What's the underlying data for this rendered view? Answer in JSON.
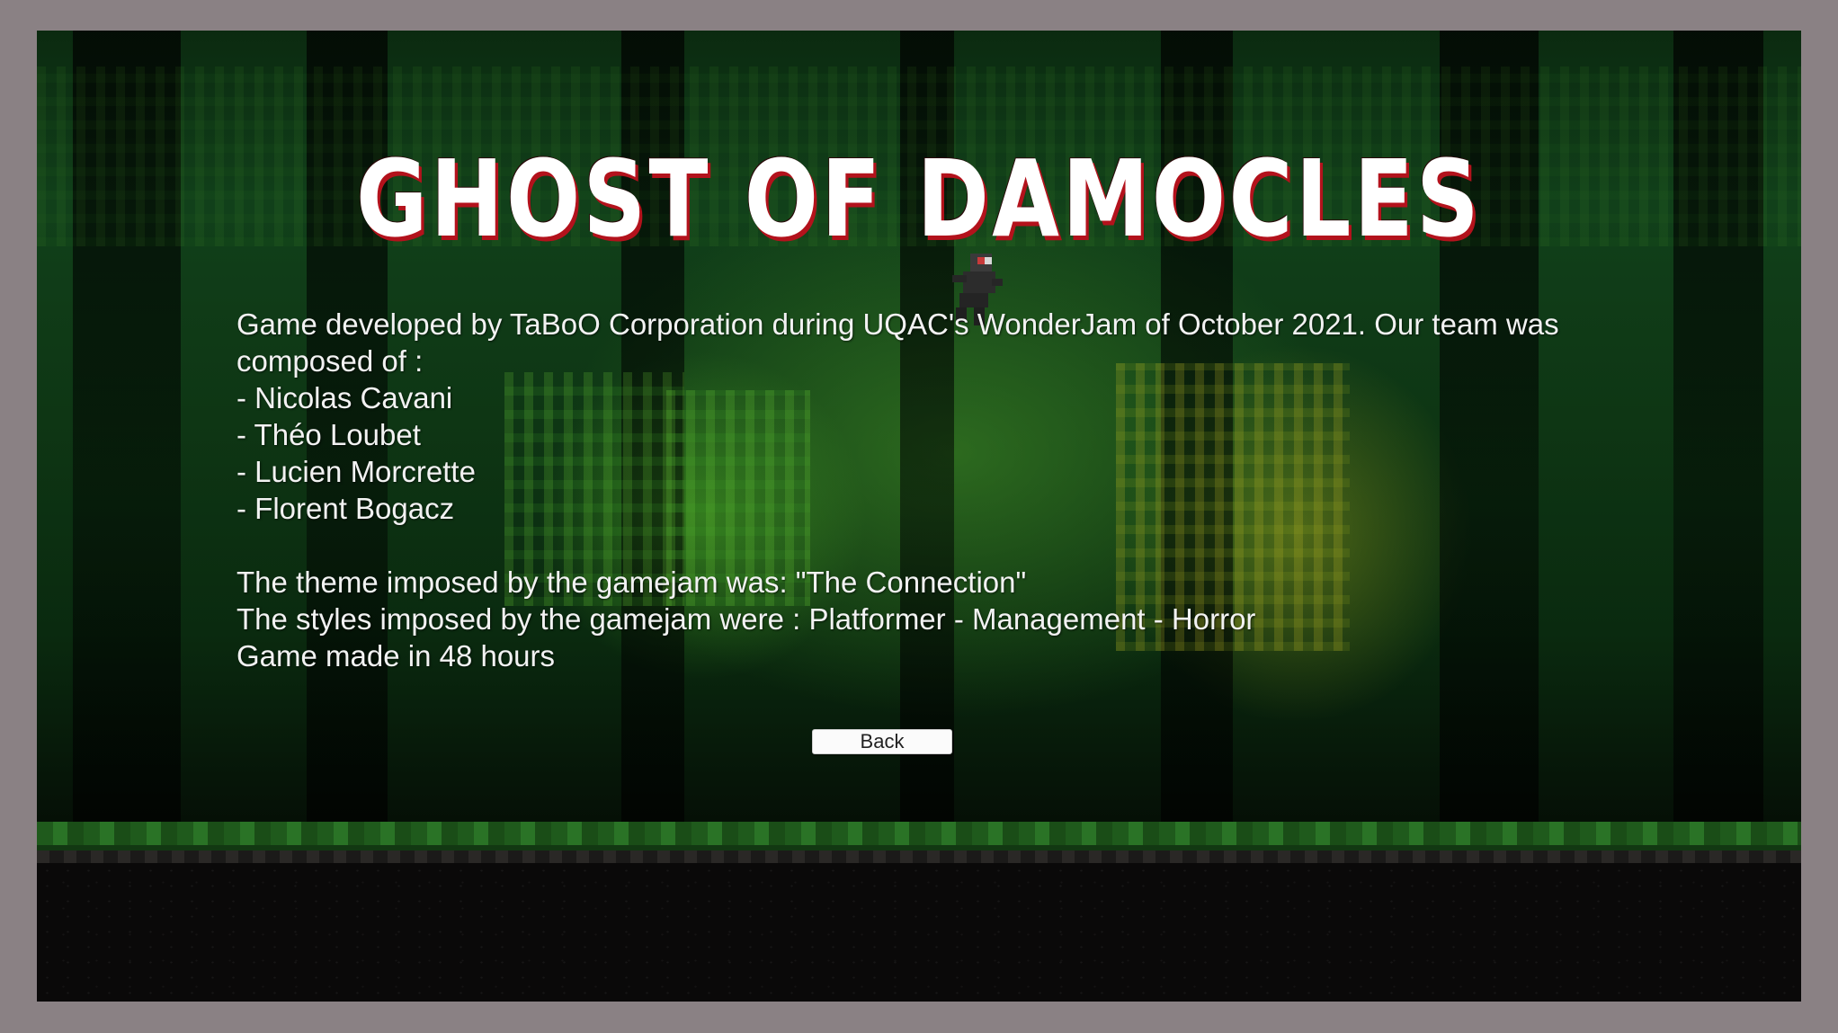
{
  "game": {
    "title": "GHOST OF DAMOCLES"
  },
  "credits": {
    "intro": "Game developed by TaBoO Corporation during UQAC's WonderJam of October 2021. Our team was composed of :",
    "members": [
      "- Nicolas Cavani",
      "- Théo Loubet",
      "- Lucien Morcrette",
      "- Florent Bogacz"
    ],
    "theme": "The theme imposed by the gamejam was:  \"The Connection\"",
    "styles": "The styles imposed by the gamejam were : Platformer - Management - Horror",
    "duration": "Game made in 48 hours"
  },
  "buttons": {
    "back_label": "Back"
  },
  "colors": {
    "title_text": "#ffffff",
    "title_shadow": "#b3121c",
    "button_bg": "#fbfbfb",
    "frame_border": "#8a8184"
  },
  "icons": {
    "character": "ghost-sprite-icon"
  }
}
